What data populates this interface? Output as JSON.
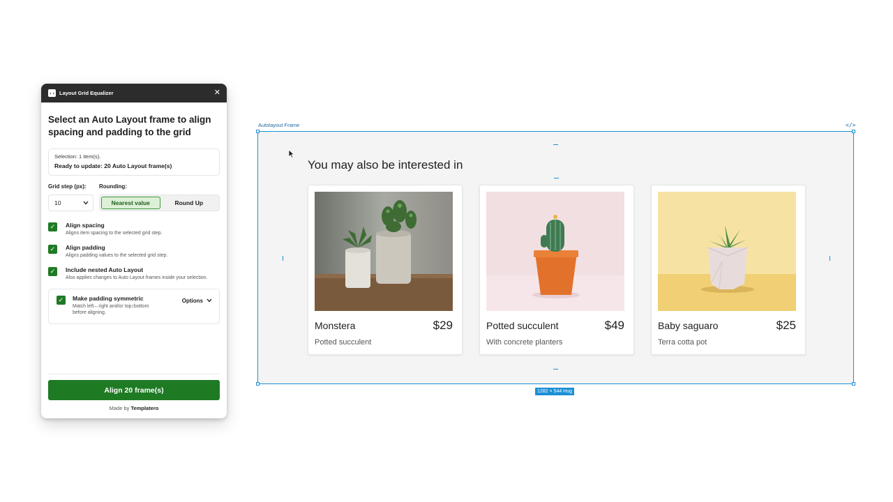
{
  "plugin": {
    "title": "Layout Grid Equalizer",
    "heading": "Select an Auto Layout frame to align spacing and padding to the grid",
    "selection_count": "Selection: 1 item(s).",
    "selection_status": "Ready to update: 20 Auto Layout frame(s)",
    "grid_step_label": "Grid step (px):",
    "grid_step_value": "10",
    "rounding_label": "Rounding:",
    "rounding_options": [
      "Nearest value",
      "Round Up"
    ],
    "rounding_selected": "Nearest value",
    "checks": [
      {
        "title": "Align spacing",
        "desc": "Aligns item spacing to the selected grid step.",
        "checked": true
      },
      {
        "title": "Align padding",
        "desc": "Aligns padding values to the selected grid step.",
        "checked": true
      },
      {
        "title": "Include nested Auto Layout",
        "desc": "Also applies changes to Auto Layout frames inside your selection.",
        "checked": true
      }
    ],
    "symmetric": {
      "title": "Make padding symmetric",
      "desc": "Match left↔right and/or top↕bottom before aligning.",
      "checked": true,
      "options_label": "Options"
    },
    "align_button": "Align 20 frame(s)",
    "made_by_prefix": "Made by",
    "made_by_name": "Templatero"
  },
  "canvas": {
    "frame_label": "Autolayout Frame",
    "frame_size_badge": "1282 × 544 Hug",
    "section_title": "You may also be interested in",
    "cards": [
      {
        "name": "Monstera",
        "price": "$29",
        "subtitle": "Potted succulent"
      },
      {
        "name": "Potted succulent",
        "price": "$49",
        "subtitle": "With concrete planters"
      },
      {
        "name": "Baby saguaro",
        "price": "$25",
        "subtitle": "Terra cotta pot"
      }
    ]
  },
  "colors": {
    "accent_green": "#1f7a24",
    "selection_blue": "#1c8fd6",
    "titlebar": "#2c2c2c"
  }
}
